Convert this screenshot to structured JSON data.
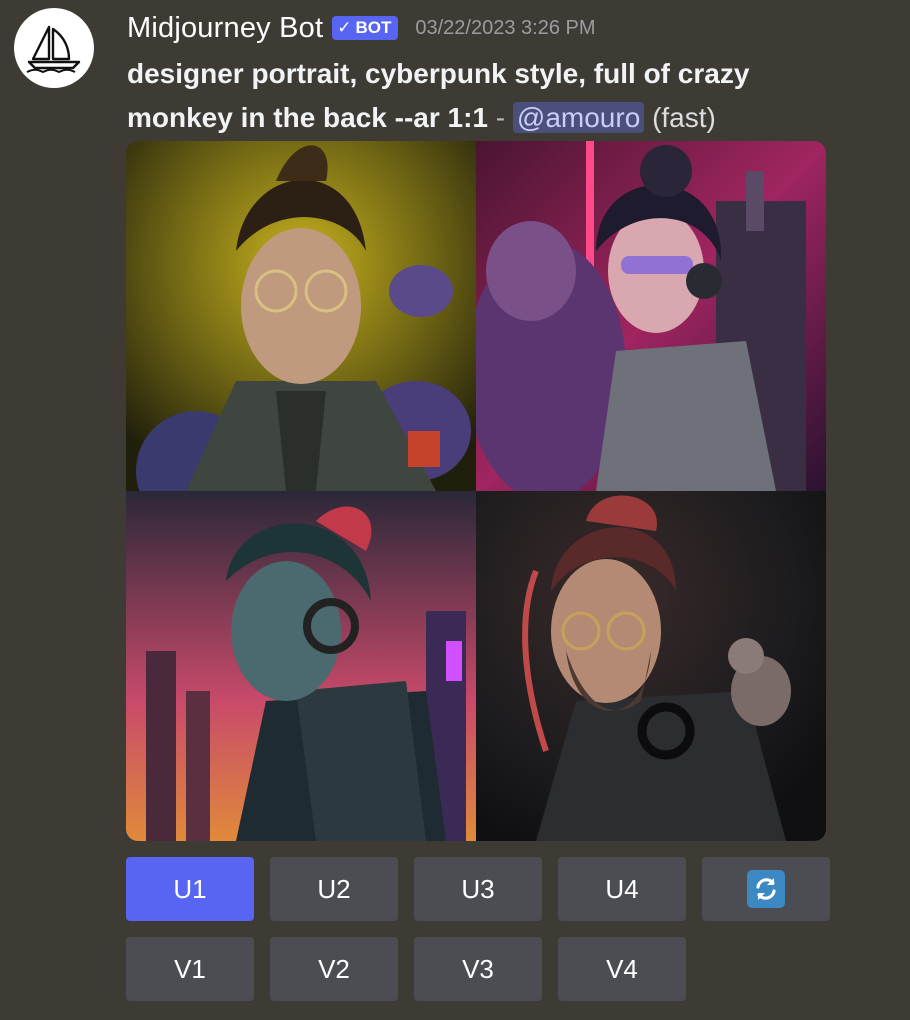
{
  "message": {
    "author": "Midjourney Bot",
    "bot_badge": "BOT",
    "timestamp": "03/22/2023 3:26 PM",
    "prompt_bold": "designer portrait, cyberpunk style, full of crazy monkey in the back --ar 1:1",
    "separator": " - ",
    "mention": "@amouro",
    "speed": "(fast)"
  },
  "images": [
    {
      "name": "image-1",
      "palette": [
        "#2c2a12",
        "#b8a21a",
        "#3e4a45"
      ]
    },
    {
      "name": "image-2",
      "palette": [
        "#2a1530",
        "#e0337a",
        "#3a3f55"
      ]
    },
    {
      "name": "image-3",
      "palette": [
        "#1a1d2e",
        "#e2506e",
        "#2f4a4f"
      ]
    },
    {
      "name": "image-4",
      "palette": [
        "#1a1a1c",
        "#c04a4a",
        "#35302c"
      ]
    }
  ],
  "buttons": {
    "row1": [
      "U1",
      "U2",
      "U3",
      "U4"
    ],
    "row2": [
      "V1",
      "V2",
      "V3",
      "V4"
    ],
    "refresh_icon": "refresh-icon"
  },
  "colors": {
    "background": "#3d3b34",
    "button": "#4b4d52",
    "button_active": "#5865f2",
    "badge": "#5865f2",
    "mention_bg": "#4b4f7c"
  }
}
